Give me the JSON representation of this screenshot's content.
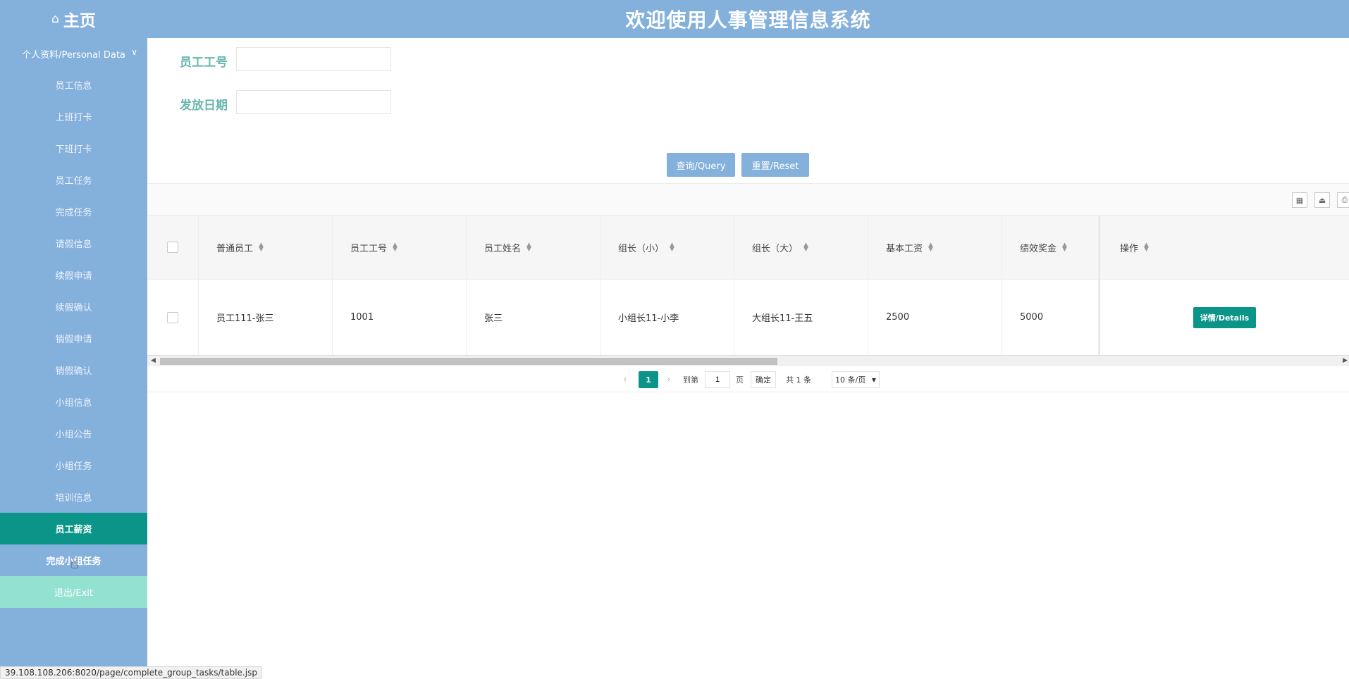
{
  "header": {
    "home_label": "主页",
    "title": "欢迎使用人事管理信息系统"
  },
  "sidebar": {
    "group_label": "个人资料/Personal Data",
    "items": [
      {
        "label": "员工信息"
      },
      {
        "label": "上班打卡"
      },
      {
        "label": "下班打卡"
      },
      {
        "label": "员工任务"
      },
      {
        "label": "完成任务"
      },
      {
        "label": "请假信息"
      },
      {
        "label": "续假申请"
      },
      {
        "label": "续假确认"
      },
      {
        "label": "销假申请"
      },
      {
        "label": "销假确认"
      },
      {
        "label": "小组信息"
      },
      {
        "label": "小组公告"
      },
      {
        "label": "小组任务"
      },
      {
        "label": "培训信息"
      },
      {
        "label": "员工薪资"
      },
      {
        "label": "完成小组任务"
      }
    ],
    "exit_label": "退出/Exit"
  },
  "search": {
    "emp_id_label": "员工工号",
    "emp_id_value": "",
    "date_label": "发放日期",
    "date_value": "",
    "query_label": "查询/Query",
    "reset_label": "重置/Reset"
  },
  "table": {
    "columns": [
      "普通员工",
      "员工工号",
      "员工姓名",
      "组长（小）",
      "组长（大）",
      "基本工资",
      "绩效奖金",
      "操作"
    ],
    "rows": [
      {
        "employee": "员工111-张三",
        "emp_id": "1001",
        "name": "张三",
        "small_leader": "小组长11-小李",
        "big_leader": "大组长11-王五",
        "base_salary": "2500",
        "bonus": "5000",
        "action_label": "详情/Details"
      }
    ]
  },
  "pager": {
    "current_page": "1",
    "goto_label": "到第",
    "goto_value": "1",
    "page_unit": "页",
    "confirm_label": "确定",
    "total_label": "共 1 条",
    "per_page": "10 条/页"
  },
  "status_url": "39.108.108.206:8020/page/complete_group_tasks/table.jsp",
  "colors": {
    "primary": "#84b0dc",
    "accent": "#0b9588",
    "exit_bg": "#93e1d1",
    "label_text": "#69b7ae"
  }
}
